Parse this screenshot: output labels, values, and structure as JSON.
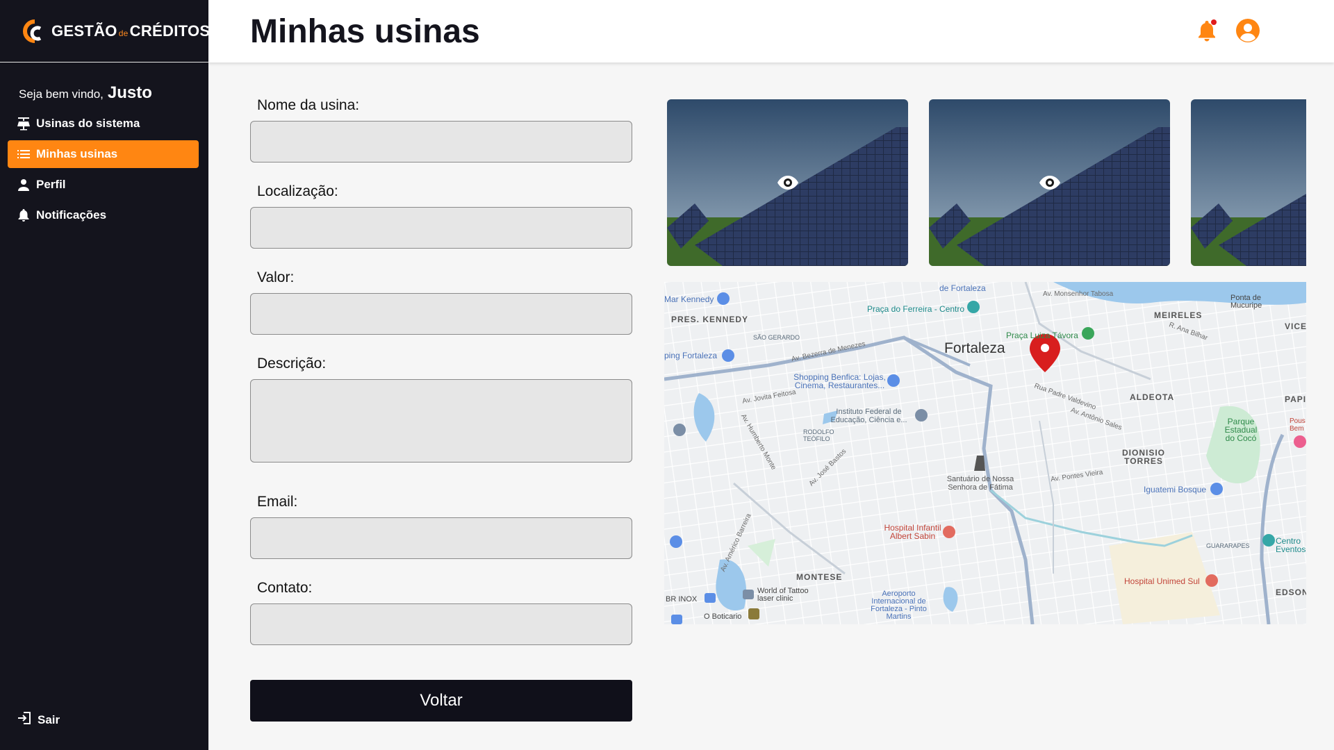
{
  "brand": {
    "part1": "GESTÃO",
    "part2": "de",
    "part3": "CRÉDITOS"
  },
  "sidebar": {
    "welcome": "Seja bem vindo,",
    "user": "Justo",
    "items": [
      {
        "label": "Usinas do sistema",
        "icon": "solar-panel-icon",
        "active": false
      },
      {
        "label": "Minhas usinas",
        "icon": "list-icon",
        "active": true
      },
      {
        "label": "Perfil",
        "icon": "person-icon",
        "active": false
      },
      {
        "label": "Notificações",
        "icon": "bell-icon",
        "active": false
      }
    ],
    "logout": "Sair"
  },
  "header": {
    "title": "Minhas usinas",
    "has_notification": true
  },
  "form": {
    "fields": [
      {
        "label": "Nome da usina:",
        "value": ""
      },
      {
        "label": "Localização:",
        "value": ""
      },
      {
        "label": "Valor:",
        "value": ""
      },
      {
        "label": "Descrição:",
        "value": ""
      },
      {
        "label": "Email:",
        "value": ""
      },
      {
        "label": "Contato:",
        "value": ""
      }
    ],
    "back_label": "Voltar"
  },
  "gallery": {
    "photos": 3,
    "icon": "eye-icon"
  },
  "map": {
    "city": "Fortaleza",
    "neighborhoods": [
      "PRES. KENNEDY",
      "MEIRELES",
      "ALDEOTA",
      "DIONISIO TORRES",
      "MONTESE",
      "EDSON",
      "VICE",
      "PAPIC",
      "SÃO GERARDO",
      "RODOLFO TEÓFILO",
      "GUARARAPES"
    ],
    "places": [
      "Mar Kennedy",
      "de Fortaleza",
      "Praça do Ferreira - Centro",
      "Praça Luiza Távora",
      "Ponta de Mucuripe",
      "ping Fortaleza",
      "Shopping Benfica: Lojas, Cinema, Restaurantes...",
      "Instituto Federal de Educação, Ciência e...",
      "Santuário de Nossa Senhora de Fátima",
      "Parque Estadual do Cocó",
      "Iguatemi Bosque",
      "Hospital Infantil Albert Sabin",
      "World of Tattoo laser clinic",
      "BR INOX",
      "O Boticario",
      "Aeroporto Internacional de Fortaleza - Pinto Martins",
      "Hospital Unimed Sul",
      "Centro Eventos",
      "Pous Bem"
    ],
    "streets": [
      "Av. Monsenhor Tabosa",
      "R. Ana Bilhar",
      "Av. Bezerra de Menezes",
      "Av. Jovita Feitosa",
      "Av. Humberto Monte",
      "Av. José Bastos",
      "Av. Américo Barreira",
      "Rua Padre Valdevino",
      "Av. Antônio Sales",
      "Av. Pontes Vieira"
    ]
  },
  "colors": {
    "accent": "#ff8612",
    "sidebar": "#14141d",
    "pin": "#d81e1e"
  }
}
